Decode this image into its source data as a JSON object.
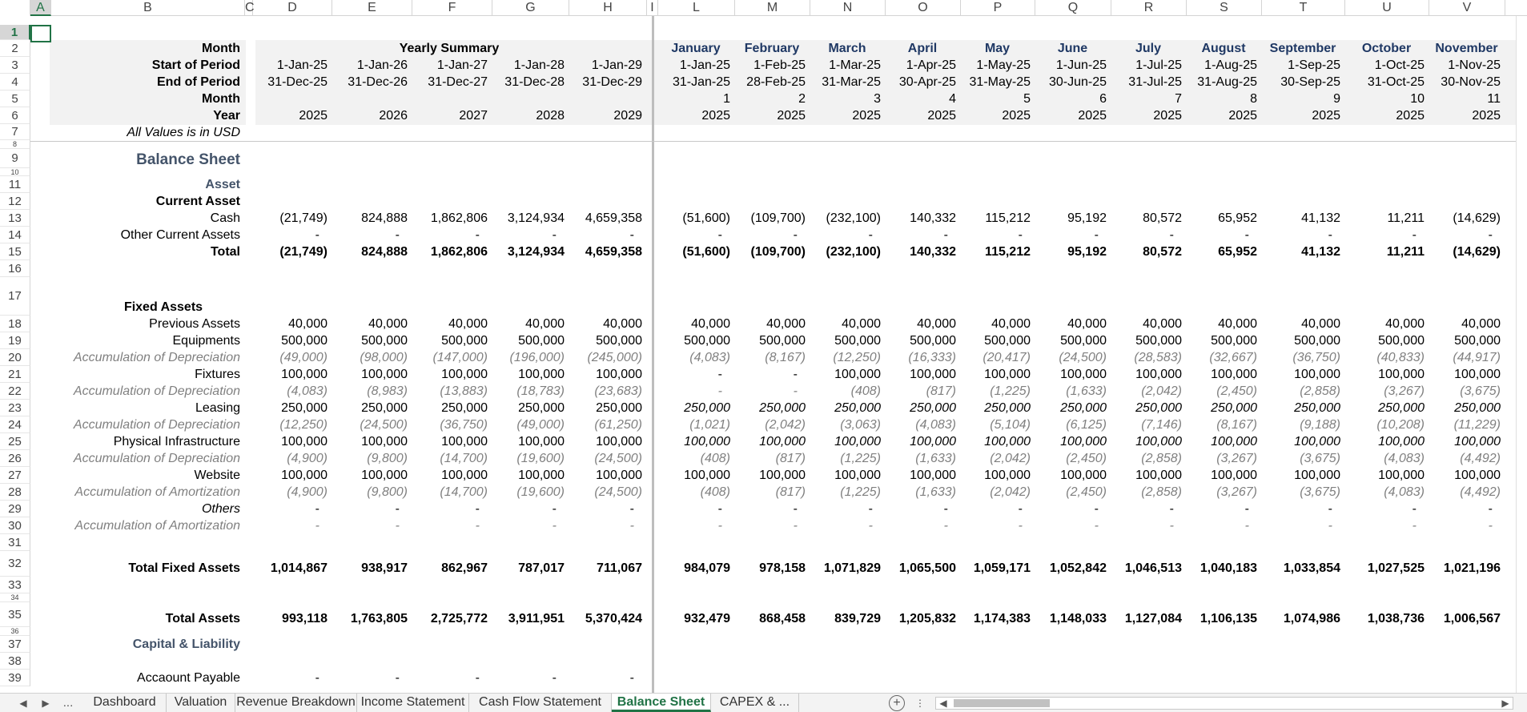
{
  "columns": [
    "A",
    "B",
    "C",
    "D",
    "E",
    "F",
    "G",
    "H",
    "I",
    "L",
    "M",
    "N",
    "O",
    "P",
    "Q",
    "R",
    "S",
    "T",
    "U",
    "V"
  ],
  "rows": [
    "1",
    "2",
    "3",
    "4",
    "5",
    "6",
    "7",
    "8",
    "9",
    "10",
    "11",
    "12",
    "13",
    "14",
    "15",
    "16",
    "17",
    "18",
    "19",
    "20",
    "21",
    "22",
    "23",
    "24",
    "25",
    "26",
    "27",
    "28",
    "29",
    "30",
    "31",
    "32",
    "33",
    "34",
    "35",
    "36",
    "37",
    "38",
    "39"
  ],
  "header": {
    "month_label": "Month",
    "start_label": "Start of Period",
    "end_label": "End of Period",
    "month_num_label": "Month",
    "year_label": "Year",
    "note": "All Values is in USD",
    "yearly_summary": "Yearly Summary",
    "yearly": {
      "start": [
        "1-Jan-25",
        "1-Jan-26",
        "1-Jan-27",
        "1-Jan-28",
        "1-Jan-29"
      ],
      "end": [
        "31-Dec-25",
        "31-Dec-26",
        "31-Dec-27",
        "31-Dec-28",
        "31-Dec-29"
      ],
      "year": [
        "2025",
        "2026",
        "2027",
        "2028",
        "2029"
      ]
    },
    "monthly": {
      "names": [
        "January",
        "February",
        "March",
        "April",
        "May",
        "June",
        "July",
        "August",
        "September",
        "October",
        "November"
      ],
      "start": [
        "1-Jan-25",
        "1-Feb-25",
        "1-Mar-25",
        "1-Apr-25",
        "1-May-25",
        "1-Jun-25",
        "1-Jul-25",
        "1-Aug-25",
        "1-Sep-25",
        "1-Oct-25",
        "1-Nov-25"
      ],
      "end": [
        "31-Jan-25",
        "28-Feb-25",
        "31-Mar-25",
        "30-Apr-25",
        "31-May-25",
        "30-Jun-25",
        "31-Jul-25",
        "31-Aug-25",
        "30-Sep-25",
        "31-Oct-25",
        "30-Nov-25"
      ],
      "month": [
        "1",
        "2",
        "3",
        "4",
        "5",
        "6",
        "7",
        "8",
        "9",
        "10",
        "11"
      ],
      "year": [
        "2025",
        "2025",
        "2025",
        "2025",
        "2025",
        "2025",
        "2025",
        "2025",
        "2025",
        "2025",
        "2025"
      ]
    }
  },
  "sheet_title": "Balance Sheet",
  "labels": {
    "asset": "Asset",
    "current_asset": "Current Asset",
    "fixed_assets": "Fixed Assets",
    "capital_liability": "Capital & Liability"
  },
  "line_items": [
    {
      "row": 13,
      "label": "Cash",
      "style": "plain",
      "yearly": [
        "(21,749)",
        "824,888",
        "1,862,806",
        "3,124,934",
        "4,659,358"
      ],
      "monthly": [
        "(51,600)",
        "(109,700)",
        "(232,100)",
        "140,332",
        "115,212",
        "95,192",
        "80,572",
        "65,952",
        "41,132",
        "11,211",
        "(14,629)"
      ]
    },
    {
      "row": 14,
      "label": "Other Current Assets",
      "style": "plain",
      "yearly": [
        "-",
        "-",
        "-",
        "-",
        "-"
      ],
      "monthly": [
        "-",
        "-",
        "-",
        "-",
        "-",
        "-",
        "-",
        "-",
        "-",
        "-",
        "-"
      ]
    },
    {
      "row": 15,
      "label": "Total",
      "style": "bold",
      "yearly": [
        "(21,749)",
        "824,888",
        "1,862,806",
        "3,124,934",
        "4,659,358"
      ],
      "monthly": [
        "(51,600)",
        "(109,700)",
        "(232,100)",
        "140,332",
        "115,212",
        "95,192",
        "80,572",
        "65,952",
        "41,132",
        "11,211",
        "(14,629)"
      ]
    },
    {
      "row": 18,
      "label": "Previous Assets",
      "style": "plain",
      "yearly": [
        "40,000",
        "40,000",
        "40,000",
        "40,000",
        "40,000"
      ],
      "monthly": [
        "40,000",
        "40,000",
        "40,000",
        "40,000",
        "40,000",
        "40,000",
        "40,000",
        "40,000",
        "40,000",
        "40,000",
        "40,000"
      ]
    },
    {
      "row": 19,
      "label": "Equipments",
      "style": "plain",
      "yearly": [
        "500,000",
        "500,000",
        "500,000",
        "500,000",
        "500,000"
      ],
      "monthly": [
        "500,000",
        "500,000",
        "500,000",
        "500,000",
        "500,000",
        "500,000",
        "500,000",
        "500,000",
        "500,000",
        "500,000",
        "500,000"
      ]
    },
    {
      "row": 20,
      "label": "Accumulation of Depreciation",
      "style": "italic",
      "yearly": [
        "(49,000)",
        "(98,000)",
        "(147,000)",
        "(196,000)",
        "(245,000)"
      ],
      "monthly": [
        "(4,083)",
        "(8,167)",
        "(12,250)",
        "(16,333)",
        "(20,417)",
        "(24,500)",
        "(28,583)",
        "(32,667)",
        "(36,750)",
        "(40,833)",
        "(44,917)"
      ]
    },
    {
      "row": 21,
      "label": "Fixtures",
      "style": "plain",
      "yearly": [
        "100,000",
        "100,000",
        "100,000",
        "100,000",
        "100,000"
      ],
      "monthly": [
        "-",
        "-",
        "100,000",
        "100,000",
        "100,000",
        "100,000",
        "100,000",
        "100,000",
        "100,000",
        "100,000",
        "100,000"
      ]
    },
    {
      "row": 22,
      "label": "Accumulation of Depreciation",
      "style": "italic",
      "yearly": [
        "(4,083)",
        "(8,983)",
        "(13,883)",
        "(18,783)",
        "(23,683)"
      ],
      "monthly": [
        "-",
        "-",
        "(408)",
        "(817)",
        "(1,225)",
        "(1,633)",
        "(2,042)",
        "(2,450)",
        "(2,858)",
        "(3,267)",
        "(3,675)"
      ]
    },
    {
      "row": 23,
      "label": "Leasing",
      "style": "plain",
      "monthly_italic": true,
      "yearly": [
        "250,000",
        "250,000",
        "250,000",
        "250,000",
        "250,000"
      ],
      "monthly": [
        "250,000",
        "250,000",
        "250,000",
        "250,000",
        "250,000",
        "250,000",
        "250,000",
        "250,000",
        "250,000",
        "250,000",
        "250,000"
      ]
    },
    {
      "row": 24,
      "label": "Accumulation of Depreciation",
      "style": "italic",
      "yearly": [
        "(12,250)",
        "(24,500)",
        "(36,750)",
        "(49,000)",
        "(61,250)"
      ],
      "monthly": [
        "(1,021)",
        "(2,042)",
        "(3,063)",
        "(4,083)",
        "(5,104)",
        "(6,125)",
        "(7,146)",
        "(8,167)",
        "(9,188)",
        "(10,208)",
        "(11,229)"
      ]
    },
    {
      "row": 25,
      "label": "Physical Infrastructure",
      "style": "plain",
      "monthly_italic": true,
      "yearly": [
        "100,000",
        "100,000",
        "100,000",
        "100,000",
        "100,000"
      ],
      "monthly": [
        "100,000",
        "100,000",
        "100,000",
        "100,000",
        "100,000",
        "100,000",
        "100,000",
        "100,000",
        "100,000",
        "100,000",
        "100,000"
      ]
    },
    {
      "row": 26,
      "label": "Accumulation of Depreciation",
      "style": "italic",
      "yearly": [
        "(4,900)",
        "(9,800)",
        "(14,700)",
        "(19,600)",
        "(24,500)"
      ],
      "monthly": [
        "(408)",
        "(817)",
        "(1,225)",
        "(1,633)",
        "(2,042)",
        "(2,450)",
        "(2,858)",
        "(3,267)",
        "(3,675)",
        "(4,083)",
        "(4,492)"
      ]
    },
    {
      "row": 27,
      "label": "Website",
      "style": "plain",
      "yearly": [
        "100,000",
        "100,000",
        "100,000",
        "100,000",
        "100,000"
      ],
      "monthly": [
        "100,000",
        "100,000",
        "100,000",
        "100,000",
        "100,000",
        "100,000",
        "100,000",
        "100,000",
        "100,000",
        "100,000",
        "100,000"
      ]
    },
    {
      "row": 28,
      "label": "Accumulation of Amortization",
      "style": "italic",
      "yearly": [
        "(4,900)",
        "(9,800)",
        "(14,700)",
        "(19,600)",
        "(24,500)"
      ],
      "monthly": [
        "(408)",
        "(817)",
        "(1,225)",
        "(1,633)",
        "(2,042)",
        "(2,450)",
        "(2,858)",
        "(3,267)",
        "(3,675)",
        "(4,083)",
        "(4,492)"
      ]
    },
    {
      "row": 29,
      "label": "Others",
      "style": "italic-dark",
      "yearly": [
        "-",
        "-",
        "-",
        "-",
        "-"
      ],
      "monthly": [
        "-",
        "-",
        "-",
        "-",
        "-",
        "-",
        "-",
        "-",
        "-",
        "-",
        "-"
      ]
    },
    {
      "row": 30,
      "label": "Accumulation of Amortization",
      "style": "italic",
      "yearly": [
        "-",
        "-",
        "-",
        "-",
        "-"
      ],
      "monthly": [
        "-",
        "-",
        "-",
        "-",
        "-",
        "-",
        "-",
        "-",
        "-",
        "-",
        "-"
      ]
    },
    {
      "row": 32,
      "label": "Total Fixed Assets",
      "style": "bold",
      "yearly": [
        "1,014,867",
        "938,917",
        "862,967",
        "787,017",
        "711,067"
      ],
      "monthly": [
        "984,079",
        "978,158",
        "1,071,829",
        "1,065,500",
        "1,059,171",
        "1,052,842",
        "1,046,513",
        "1,040,183",
        "1,033,854",
        "1,027,525",
        "1,021,196"
      ]
    },
    {
      "row": 35,
      "label": "Total Assets",
      "style": "bold",
      "yearly": [
        "993,118",
        "1,763,805",
        "2,725,772",
        "3,911,951",
        "5,370,424"
      ],
      "monthly": [
        "932,479",
        "868,458",
        "839,729",
        "1,205,832",
        "1,174,383",
        "1,148,033",
        "1,127,084",
        "1,106,135",
        "1,074,986",
        "1,038,736",
        "1,006,567"
      ]
    },
    {
      "row": 39,
      "label": "Accaount Payable",
      "style": "plain",
      "yearly": [
        "-",
        "-",
        "-",
        "-",
        "-"
      ],
      "monthly": [
        "",
        "",
        "",
        "",
        "",
        "",
        "",
        "",
        "",
        "",
        ""
      ]
    }
  ],
  "tabs": {
    "ellipsis": "...",
    "items": [
      "Dashboard",
      "Valuation",
      "Revenue Breakdown",
      "Income Statement",
      "Cash Flow Statement",
      "Balance Sheet",
      "CAPEX & ..."
    ],
    "active": "Balance Sheet",
    "add_symbol": "+",
    "more_symbol": "⋮"
  },
  "colors": {
    "accent": "#217346",
    "navy_label": "#44546a",
    "month_header": "#1f3864",
    "band": "#f2f2f2"
  }
}
